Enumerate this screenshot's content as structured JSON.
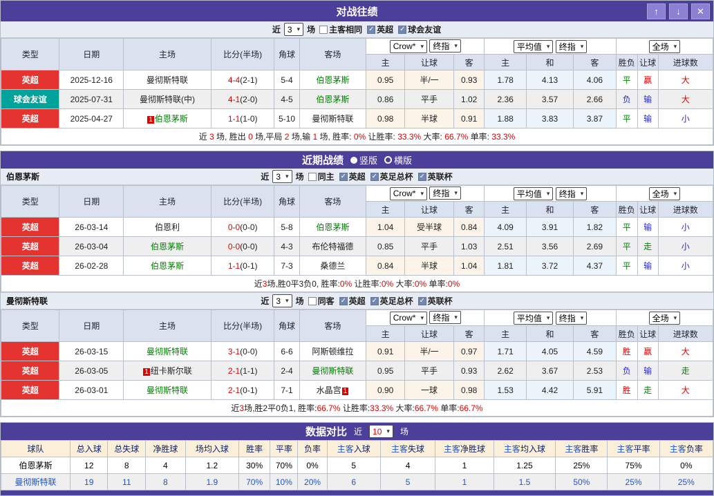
{
  "colors": {
    "purple": "#4C3F99",
    "league_red": "#E5342F",
    "league_teal": "#00A39B",
    "win_red": "#E00000",
    "lose_blue": "#2A2AD5",
    "draw_green": "#008000",
    "link_blue": "#2353CC"
  },
  "cols": {
    "type": "类型",
    "date": "日期",
    "home": "主场",
    "score": "比分(半场)",
    "corner": "角球",
    "away": "客场",
    "sub": [
      "主",
      "让球",
      "客",
      "主",
      "和",
      "客",
      "胜负",
      "让球",
      "进球数"
    ],
    "dd": {
      "crow": "Crow*",
      "final": "终指",
      "avg": "平均值",
      "full": "全场"
    },
    "arrow": "▾"
  },
  "h2h": {
    "title": "对战往绩",
    "buttons": {
      "up": "↑",
      "down": "↓",
      "close": "✕"
    },
    "controls": {
      "near": "近",
      "count": "3",
      "unit": "场",
      "boxes": [
        {
          "label": "主客相同",
          "cls": "ckb off"
        },
        {
          "label": "英超",
          "cls": "ckb on"
        },
        {
          "label": "球会友谊",
          "cls": "ckb on"
        }
      ]
    },
    "rows": [
      {
        "type": "英超",
        "type_cls": "lg-red",
        "date": "2025-12-16",
        "card_pre": "",
        "home": "曼彻斯特联",
        "home_cls": "",
        "score": "4-4",
        "half": "(2-1)",
        "corner": "5-4",
        "away": "伯恩茅斯",
        "away_cls": "tm-g",
        "card_post": "",
        "odds": [
          "0.95",
          "半/一",
          "0.93"
        ],
        "avg": [
          "1.78",
          "4.13",
          "4.06"
        ],
        "res": [
          {
            "t": "平",
            "c": "c-g"
          },
          {
            "t": "赢",
            "c": "c-r"
          },
          {
            "t": "大",
            "c": "c-r"
          }
        ]
      },
      {
        "type": "球会友谊",
        "type_cls": "lg-teal",
        "date": "2025-07-31",
        "card_pre": "",
        "home": "曼彻斯特联(中)",
        "home_cls": "",
        "score": "4-1",
        "half": "(2-0)",
        "corner": "4-5",
        "away": "伯恩茅斯",
        "away_cls": "tm-g",
        "card_post": "",
        "odds": [
          "0.86",
          "平手",
          "1.02"
        ],
        "avg": [
          "2.36",
          "3.57",
          "2.66"
        ],
        "res": [
          {
            "t": "负",
            "c": "c-b"
          },
          {
            "t": "输",
            "c": "c-b"
          },
          {
            "t": "大",
            "c": "c-r"
          }
        ]
      },
      {
        "type": "英超",
        "type_cls": "lg-red",
        "date": "2025-04-27",
        "card_pre": "1",
        "home": "伯恩茅斯",
        "home_cls": "tm-g",
        "score": "1-1",
        "half": "(1-0)",
        "corner": "5-10",
        "away": "曼彻斯特联",
        "away_cls": "",
        "card_post": "",
        "odds": [
          "0.98",
          "半球",
          "0.91"
        ],
        "avg": [
          "1.88",
          "3.83",
          "3.87"
        ],
        "res": [
          {
            "t": "平",
            "c": "c-g"
          },
          {
            "t": "输",
            "c": "c-b"
          },
          {
            "t": "小",
            "c": "c-b"
          }
        ]
      }
    ],
    "summary": [
      {
        "t": "近 ",
        "c": ""
      },
      {
        "t": "3",
        "c": "rn"
      },
      {
        "t": " 场, 胜出 ",
        "c": ""
      },
      {
        "t": "0",
        "c": "rn"
      },
      {
        "t": " 场,平局 ",
        "c": ""
      },
      {
        "t": "2",
        "c": "rn"
      },
      {
        "t": " 场,输 ",
        "c": ""
      },
      {
        "t": "1",
        "c": "rn"
      },
      {
        "t": " 场, 胜率: ",
        "c": ""
      },
      {
        "t": "0%",
        "c": "rn"
      },
      {
        "t": " 让胜率: ",
        "c": ""
      },
      {
        "t": "33.3%",
        "c": "rn"
      },
      {
        "t": " 大率: ",
        "c": ""
      },
      {
        "t": "66.7%",
        "c": "rn"
      },
      {
        "t": " 单率: ",
        "c": ""
      },
      {
        "t": "33.3%",
        "c": "rn"
      }
    ]
  },
  "recent": {
    "title": "近期战绩",
    "radios": [
      {
        "label": "竖版",
        "cls": "rd filled"
      },
      {
        "label": "横版",
        "cls": "rd ring"
      }
    ],
    "bmu": {
      "name": "伯恩茅斯",
      "controls": {
        "near": "近",
        "count": "3",
        "unit": "场",
        "boxes": [
          {
            "label": "同主",
            "cls": "ckb off"
          },
          {
            "label": "英超",
            "cls": "ckb on"
          },
          {
            "label": "英足总杯",
            "cls": "ckb on"
          },
          {
            "label": "英联杯",
            "cls": "ckb on"
          }
        ]
      },
      "rows": [
        {
          "type": "英超",
          "type_cls": "lg-red",
          "date": "26-03-14",
          "card_pre": "",
          "home": "伯恩利",
          "home_cls": "",
          "score": "0-0",
          "half": "(0-0)",
          "corner": "5-8",
          "away": "伯恩茅斯",
          "away_cls": "tm-g",
          "card_post": "",
          "odds": [
            "1.04",
            "受半球",
            "0.84"
          ],
          "avg": [
            "4.09",
            "3.91",
            "1.82"
          ],
          "res": [
            {
              "t": "平",
              "c": "c-g"
            },
            {
              "t": "输",
              "c": "c-b"
            },
            {
              "t": "小",
              "c": "c-b"
            }
          ]
        },
        {
          "type": "英超",
          "type_cls": "lg-red",
          "date": "26-03-04",
          "card_pre": "",
          "home": "伯恩茅斯",
          "home_cls": "tm-g",
          "score": "0-0",
          "half": "(0-0)",
          "corner": "4-3",
          "away": "布伦特福德",
          "away_cls": "",
          "card_post": "",
          "odds": [
            "0.85",
            "平手",
            "1.03"
          ],
          "avg": [
            "2.51",
            "3.56",
            "2.69"
          ],
          "res": [
            {
              "t": "平",
              "c": "c-g"
            },
            {
              "t": "走",
              "c": "c-g"
            },
            {
              "t": "小",
              "c": "c-b"
            }
          ]
        },
        {
          "type": "英超",
          "type_cls": "lg-red",
          "date": "26-02-28",
          "card_pre": "",
          "home": "伯恩茅斯",
          "home_cls": "tm-g",
          "score": "1-1",
          "half": "(0-1)",
          "corner": "7-3",
          "away": "桑德兰",
          "away_cls": "",
          "card_post": "",
          "odds": [
            "0.84",
            "半球",
            "1.04"
          ],
          "avg": [
            "1.81",
            "3.72",
            "4.37"
          ],
          "res": [
            {
              "t": "平",
              "c": "c-g"
            },
            {
              "t": "输",
              "c": "c-b"
            },
            {
              "t": "小",
              "c": "c-b"
            }
          ]
        }
      ],
      "summary": [
        {
          "t": "近",
          "c": ""
        },
        {
          "t": "3",
          "c": "rn"
        },
        {
          "t": "场,胜0平3负0, 胜率:",
          "c": ""
        },
        {
          "t": "0%",
          "c": "rn"
        },
        {
          "t": " 让胜率:",
          "c": ""
        },
        {
          "t": "0%",
          "c": "rn"
        },
        {
          "t": " 大率:",
          "c": ""
        },
        {
          "t": "0%",
          "c": "rn"
        },
        {
          "t": " 单率:",
          "c": ""
        },
        {
          "t": "0%",
          "c": "rn"
        }
      ]
    },
    "mu": {
      "name": "曼彻斯特联",
      "controls": {
        "near": "近",
        "count": "3",
        "unit": "场",
        "boxes": [
          {
            "label": "同客",
            "cls": "ckb off"
          },
          {
            "label": "英超",
            "cls": "ckb on"
          },
          {
            "label": "英足总杯",
            "cls": "ckb on"
          },
          {
            "label": "英联杯",
            "cls": "ckb on"
          }
        ]
      },
      "rows": [
        {
          "type": "英超",
          "type_cls": "lg-red",
          "date": "26-03-15",
          "card_pre": "",
          "home": "曼彻斯特联",
          "home_cls": "tm-g",
          "score": "3-1",
          "half": "(0-0)",
          "corner": "6-6",
          "away": "阿斯顿维拉",
          "away_cls": "",
          "card_post": "",
          "odds": [
            "0.91",
            "半/一",
            "0.97"
          ],
          "avg": [
            "1.71",
            "4.05",
            "4.59"
          ],
          "res": [
            {
              "t": "胜",
              "c": "c-r"
            },
            {
              "t": "赢",
              "c": "c-r"
            },
            {
              "t": "大",
              "c": "c-r"
            }
          ]
        },
        {
          "type": "英超",
          "type_cls": "lg-red",
          "date": "26-03-05",
          "card_pre": "1",
          "home": "纽卡斯尔联",
          "home_cls": "",
          "score": "2-1",
          "half": "(1-1)",
          "corner": "2-4",
          "away": "曼彻斯特联",
          "away_cls": "tm-g",
          "card_post": "",
          "odds": [
            "0.95",
            "平手",
            "0.93"
          ],
          "avg": [
            "2.62",
            "3.67",
            "2.53"
          ],
          "res": [
            {
              "t": "负",
              "c": "c-b"
            },
            {
              "t": "输",
              "c": "c-b"
            },
            {
              "t": "走",
              "c": "c-g"
            }
          ]
        },
        {
          "type": "英超",
          "type_cls": "lg-red",
          "date": "26-03-01",
          "card_pre": "",
          "home": "曼彻斯特联",
          "home_cls": "tm-g",
          "score": "2-1",
          "half": "(0-1)",
          "corner": "7-1",
          "away": "水晶宫",
          "away_cls": "",
          "card_post": "1",
          "odds": [
            "0.90",
            "一球",
            "0.98"
          ],
          "avg": [
            "1.53",
            "4.42",
            "5.91"
          ],
          "res": [
            {
              "t": "胜",
              "c": "c-r"
            },
            {
              "t": "走",
              "c": "c-g"
            },
            {
              "t": "大",
              "c": "c-r"
            }
          ]
        }
      ],
      "summary": [
        {
          "t": "近",
          "c": ""
        },
        {
          "t": "3",
          "c": "rn"
        },
        {
          "t": "场,胜2平0负1, 胜率:",
          "c": ""
        },
        {
          "t": "66.7%",
          "c": "rn"
        },
        {
          "t": " 让胜率:",
          "c": ""
        },
        {
          "t": "33.3%",
          "c": "rn"
        },
        {
          "t": " 大率:",
          "c": ""
        },
        {
          "t": "66.7%",
          "c": "rn"
        },
        {
          "t": " 单率:",
          "c": ""
        },
        {
          "t": "66.7%",
          "c": "rn"
        }
      ]
    }
  },
  "compare": {
    "title": "数据对比",
    "near": "近",
    "count": "10",
    "unit": "场",
    "headers": [
      {
        "p": "",
        "t": "球队"
      },
      {
        "p": "",
        "t": "总入球"
      },
      {
        "p": "",
        "t": "总失球"
      },
      {
        "p": "",
        "t": "净胜球"
      },
      {
        "p": "",
        "t": "场均入球"
      },
      {
        "p": "",
        "t": "胜率"
      },
      {
        "p": "",
        "t": "平率"
      },
      {
        "p": "",
        "t": "负率"
      },
      {
        "p": "主客",
        "t": "入球"
      },
      {
        "p": "主客",
        "t": "失球"
      },
      {
        "p": "主客",
        "t": "净胜球"
      },
      {
        "p": "主客",
        "t": "均入球"
      },
      {
        "p": "主客",
        "t": "胜率"
      },
      {
        "p": "主客",
        "t": "平率"
      },
      {
        "p": "主客",
        "t": "负率"
      }
    ],
    "rows": [
      {
        "name": "伯恩茅斯",
        "vals": [
          "12",
          "8",
          "4",
          "1.2",
          "30%",
          "70%",
          "0%",
          "5",
          "4",
          "1",
          "1.25",
          "25%",
          "75%",
          "0%"
        ]
      },
      {
        "name": "曼彻斯特联",
        "vals": [
          "19",
          "11",
          "8",
          "1.9",
          "70%",
          "10%",
          "20%",
          "6",
          "5",
          "1",
          "1.5",
          "50%",
          "25%",
          "25%"
        ]
      }
    ]
  }
}
